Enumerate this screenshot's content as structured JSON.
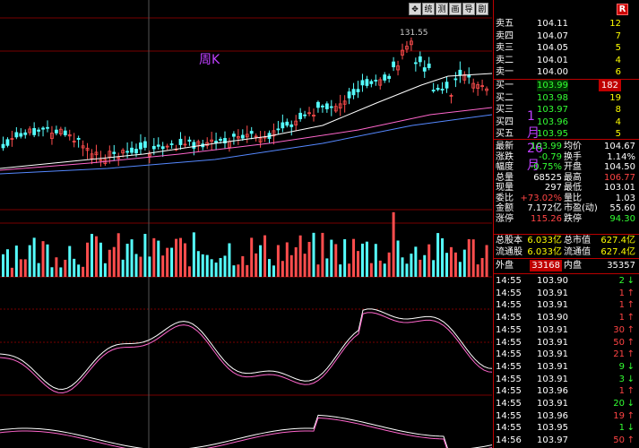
{
  "toolbar": {
    "move_icon": "✥",
    "buttons": [
      "统",
      "测",
      "画",
      "导",
      "剧"
    ],
    "close": "R"
  },
  "chart": {
    "label_period": "周K",
    "label_date": "1月26月",
    "peak_price": "131.55"
  },
  "orderbook": {
    "sell": [
      {
        "label": "卖五",
        "price": "104.11",
        "vol": "12"
      },
      {
        "label": "卖四",
        "price": "104.07",
        "vol": "7"
      },
      {
        "label": "卖三",
        "price": "104.05",
        "vol": "5"
      },
      {
        "label": "卖二",
        "price": "104.01",
        "vol": "4"
      },
      {
        "label": "卖一",
        "price": "104.00",
        "vol": "6"
      }
    ],
    "buy": [
      {
        "label": "买一",
        "price": "103.99",
        "vol": "182"
      },
      {
        "label": "买二",
        "price": "103.98",
        "vol": "19"
      },
      {
        "label": "买三",
        "price": "103.97",
        "vol": "8"
      },
      {
        "label": "买四",
        "price": "103.96",
        "vol": "4"
      },
      {
        "label": "买五",
        "price": "103.95",
        "vol": "5"
      }
    ]
  },
  "stats": [
    {
      "l1": "最新",
      "v1": "103.99",
      "c1": "green",
      "l2": "均价",
      "v2": "104.67",
      "c2": "white"
    },
    {
      "l1": "涨跌",
      "v1": "-0.79",
      "c1": "green",
      "l2": "换手",
      "v2": "1.14%",
      "c2": "white"
    },
    {
      "l1": "幅度",
      "v1": "-0.75%",
      "c1": "green",
      "l2": "开盘",
      "v2": "104.50",
      "c2": "white"
    },
    {
      "l1": "总量",
      "v1": "68525",
      "c1": "white",
      "l2": "最高",
      "v2": "106.77",
      "c2": "red"
    },
    {
      "l1": "现量",
      "v1": "297",
      "c1": "white",
      "l2": "最低",
      "v2": "103.01",
      "c2": "white"
    },
    {
      "l1": "委比",
      "v1": "+73.02%",
      "c1": "red",
      "l2": "量比",
      "v2": "1.03",
      "c2": "white"
    },
    {
      "l1": "金额",
      "v1": "7.172亿",
      "c1": "white",
      "l2": "市盈(动)",
      "v2": "55.60",
      "c2": "white"
    },
    {
      "l1": "涨停",
      "v1": "115.26",
      "c1": "red",
      "l2": "跌停",
      "v2": "94.30",
      "c2": "green"
    }
  ],
  "capital": [
    {
      "l1": "总股本",
      "v1": "6.033亿",
      "l2": "总市值",
      "v2": "627.4亿"
    },
    {
      "l1": "流通股",
      "v1": "6.033亿",
      "l2": "流通值",
      "v2": "627.4亿"
    }
  ],
  "outer_inner": {
    "l1": "外盘",
    "v1": "33168",
    "l2": "内盘",
    "v2": "35357"
  },
  "ticks": [
    {
      "time": "14:55",
      "price": "103.90",
      "vol": "2",
      "dir": "↓",
      "color": "green"
    },
    {
      "time": "14:55",
      "price": "103.91",
      "vol": "1",
      "dir": "↑",
      "color": "red"
    },
    {
      "time": "14:55",
      "price": "103.91",
      "vol": "1",
      "dir": "↑",
      "color": "red"
    },
    {
      "time": "14:55",
      "price": "103.90",
      "vol": "1",
      "dir": "↑",
      "color": "red"
    },
    {
      "time": "14:55",
      "price": "103.91",
      "vol": "30",
      "dir": "↑",
      "color": "red"
    },
    {
      "time": "14:55",
      "price": "103.91",
      "vol": "50",
      "dir": "↑",
      "color": "red"
    },
    {
      "time": "14:55",
      "price": "103.91",
      "vol": "21",
      "dir": "↑",
      "color": "red"
    },
    {
      "time": "14:55",
      "price": "103.91",
      "vol": "9",
      "dir": "↓",
      "color": "green"
    },
    {
      "time": "14:55",
      "price": "103.91",
      "vol": "3",
      "dir": "↓",
      "color": "green"
    },
    {
      "time": "14:55",
      "price": "103.96",
      "vol": "1",
      "dir": "↑",
      "color": "red"
    },
    {
      "time": "14:55",
      "price": "103.91",
      "vol": "20",
      "dir": "↓",
      "color": "green"
    },
    {
      "time": "14:55",
      "price": "103.96",
      "vol": "19",
      "dir": "↑",
      "color": "red"
    },
    {
      "time": "14:55",
      "price": "103.95",
      "vol": "1",
      "dir": "↓",
      "color": "green"
    },
    {
      "time": "14:56",
      "price": "103.97",
      "vol": "50",
      "dir": "↑",
      "color": "red"
    }
  ]
}
